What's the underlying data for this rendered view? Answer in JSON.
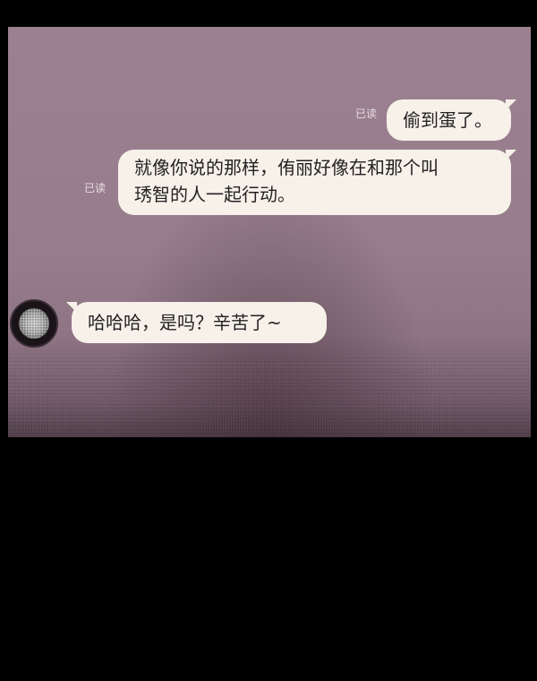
{
  "chat": {
    "messages": [
      {
        "side": "right",
        "status": "已读",
        "text": "偷到蛋了。"
      },
      {
        "side": "right",
        "status": "已读",
        "text_line1": "就像你说的那样，侑丽好像在和那个叫",
        "text_line2": "琇智的人一起行动。"
      },
      {
        "side": "left",
        "text": "哈哈哈，是吗？辛苦了~"
      }
    ]
  },
  "colors": {
    "background": "#000000",
    "panel": "#977d8c",
    "bubble": "#f8f1ea",
    "read_status": "#e9dce3"
  },
  "icons": {
    "avatar": "contact-avatar-icon"
  }
}
